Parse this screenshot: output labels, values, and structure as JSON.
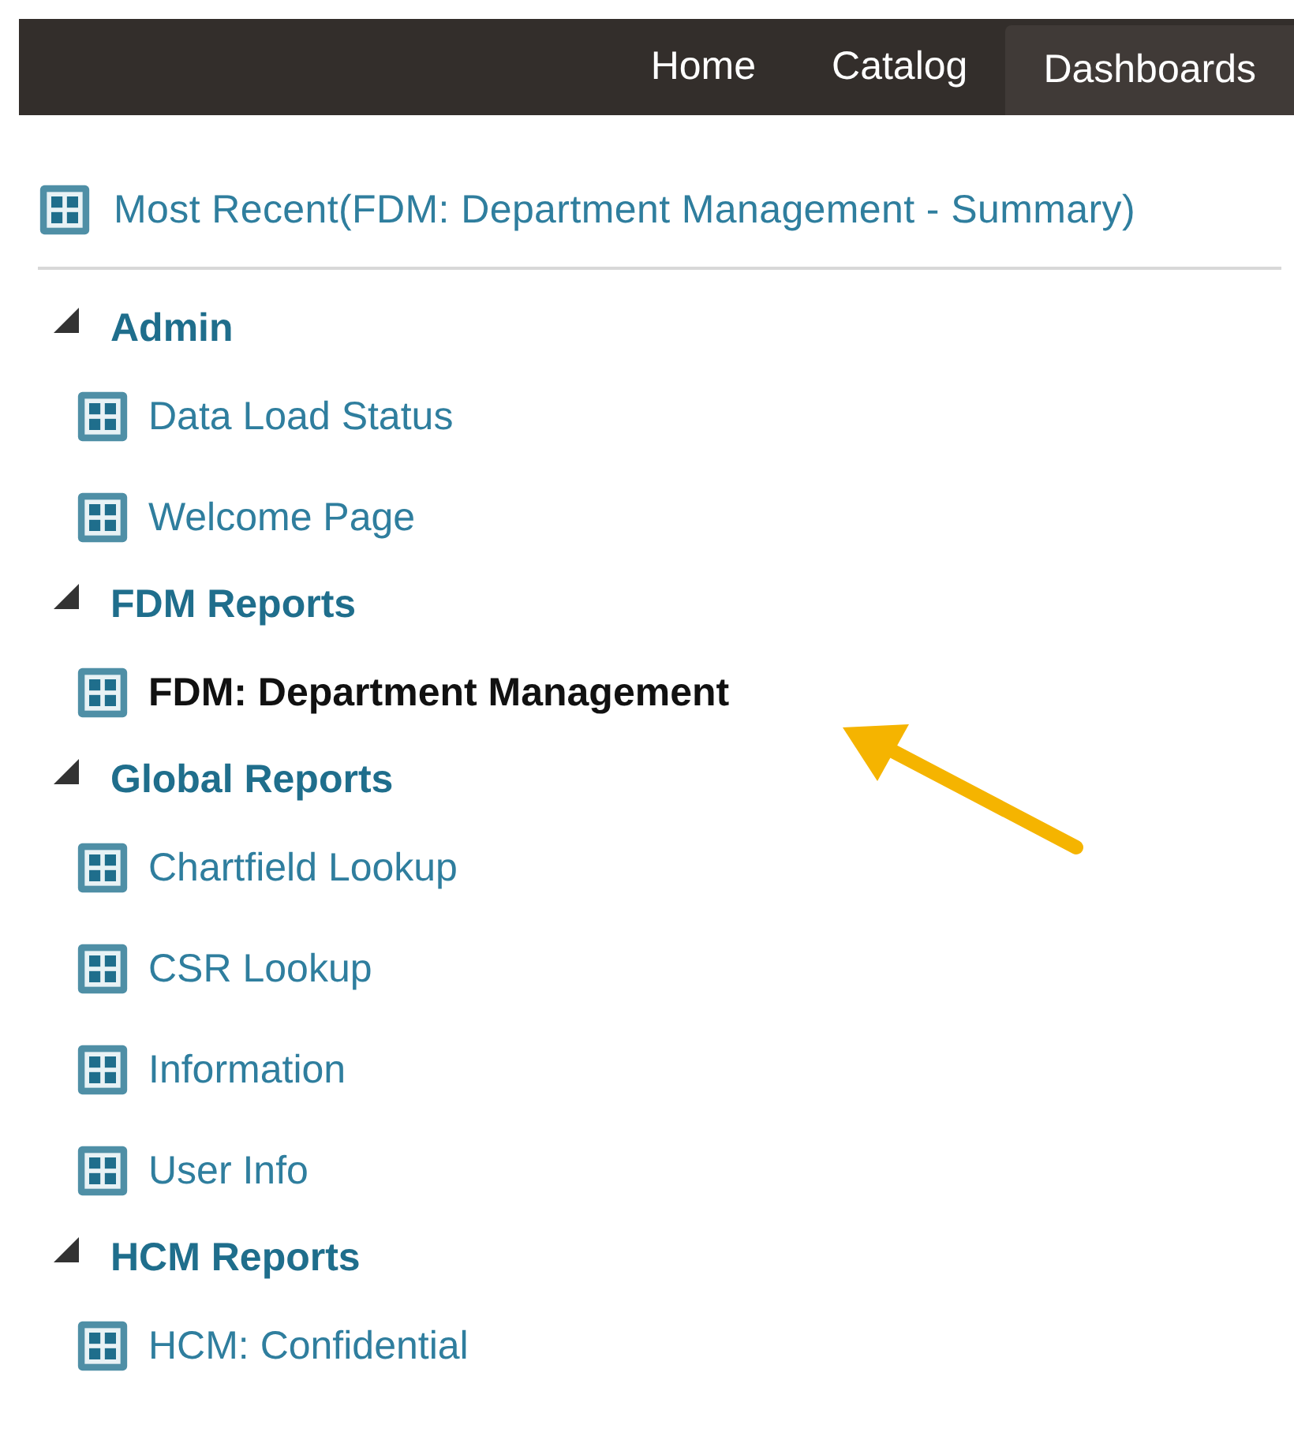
{
  "nav": {
    "tabs": [
      {
        "label": "Home",
        "selected": false
      },
      {
        "label": "Catalog",
        "selected": false
      },
      {
        "label": "Dashboards",
        "selected": true
      }
    ]
  },
  "most_recent": {
    "label": "Most Recent(FDM: Department Management - Summary)"
  },
  "groups": [
    {
      "title": "Admin",
      "expanded": true,
      "items": [
        {
          "label": "Data Load Status",
          "selected": false
        },
        {
          "label": "Welcome Page",
          "selected": false
        }
      ]
    },
    {
      "title": "FDM Reports",
      "expanded": true,
      "items": [
        {
          "label": "FDM: Department Management",
          "selected": true
        }
      ]
    },
    {
      "title": "Global Reports",
      "expanded": true,
      "items": [
        {
          "label": "Chartfield Lookup",
          "selected": false
        },
        {
          "label": "CSR Lookup",
          "selected": false
        },
        {
          "label": "Information",
          "selected": false
        },
        {
          "label": "User Info",
          "selected": false
        }
      ]
    },
    {
      "title": "HCM Reports",
      "expanded": true,
      "items": [
        {
          "label": "HCM: Confidential",
          "selected": false
        }
      ]
    }
  ]
}
